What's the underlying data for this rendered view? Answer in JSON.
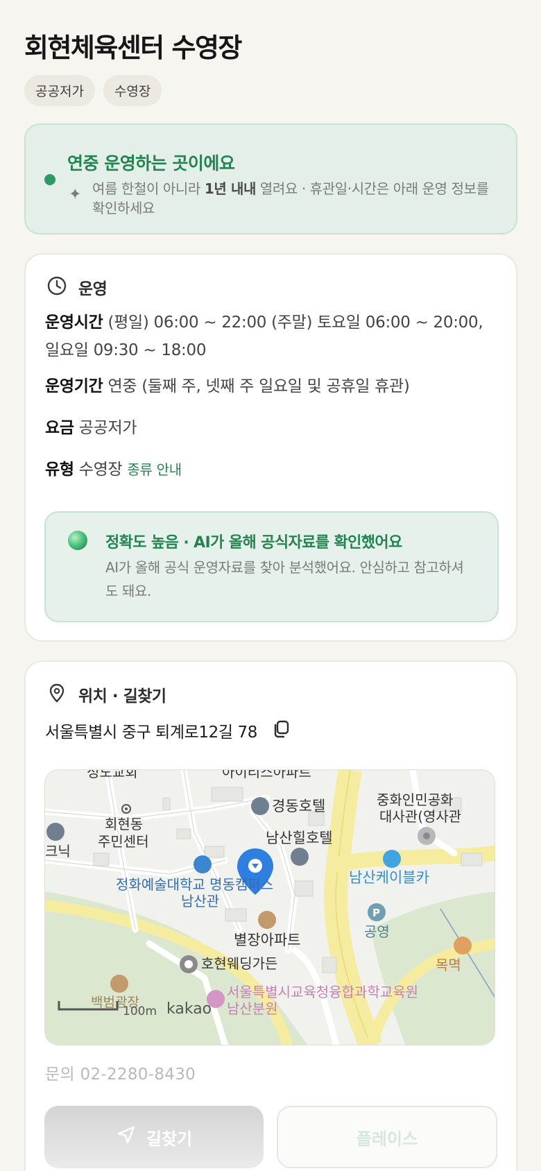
{
  "title": "회현체육센터 수영장",
  "tags": [
    "공공저가",
    "수영장"
  ],
  "notice": {
    "title": "연중 운영하는 곳이에요",
    "body_prefix": "여름 한철이 아니라 ",
    "body_bold": "1년 내내",
    "body_suffix": " 열려요 · 휴관일·시간은 아래 운영 정보를 확인하세요"
  },
  "operation": {
    "heading": "운영",
    "hours_label": "운영시간",
    "hours_value": "(평일) 06:00 ~ 22:00 (주말) 토요일 06:00 ~ 20:00, 일요일 09:30 ~ 18:00",
    "period_label": "운영기간",
    "period_value": "연중 (둘째 주, 넷째 주 일요일 및 공휴일 휴관)",
    "fee_label": "요금",
    "fee_value": "공공저가",
    "type_label": "유형",
    "type_value": "수영장",
    "type_link": "종류 안내"
  },
  "ai_check": {
    "title": "정확도 높음 · AI가 올해 공식자료를 확인했어요",
    "body": "AI가 올해 공식 운영자료를 찾아 분석했어요. 안심하고 참고하셔도 돼요."
  },
  "location": {
    "heading": "위치 · 길찾기",
    "address": "서울특별시 중구 퇴계로12길 78",
    "map_labels": {
      "church": "성도교회",
      "apartment_top": "아이리스아파트",
      "community_center_1": "회현동",
      "community_center_2": "주민센터",
      "clinic": "크닉",
      "hotel_1": "경동호텔",
      "hotel_2": "남산힐호텔",
      "embassy_1": "중화인민공화",
      "embassy_2": "대사관(영사관",
      "university_1": "정화예술대학교 명동캠퍼스",
      "university_2": "남산관",
      "cable_car": "남산케이블카",
      "parking": "공영",
      "apartment": "별장아파트",
      "wedding": "호현웨딩가든",
      "restaurant": "목멱",
      "museum": "백범광장",
      "education_1": "서울특별시교육청융합과학교육원",
      "education_2": "남산분원",
      "scale": "100m",
      "brand": "kakao"
    },
    "inquiry": "문의 02-2280-8430"
  },
  "buttons": {
    "route": "길찾기",
    "place": "플레이스"
  },
  "colors": {
    "accent_green": "#23844f",
    "notice_bg": "#e3efe8",
    "map_pin": "#2f7fe0"
  }
}
